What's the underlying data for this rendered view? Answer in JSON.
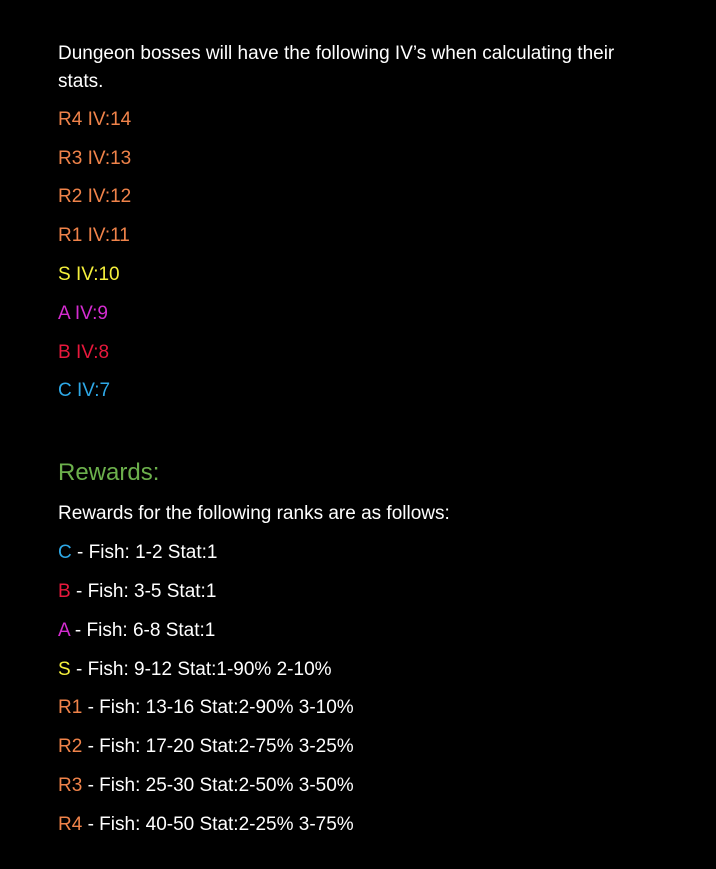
{
  "colors": {
    "background": "#000000",
    "text": "#ffffff",
    "rank_R": "#f0834a",
    "rank_S": "#f5f03c",
    "rank_A": "#d42cd0",
    "rank_B": "#e8183c",
    "rank_C": "#2ea8e6",
    "heading": "#6cb04c"
  },
  "intro": "Dungeon bosses will have the following IV’s when calculating their stats.",
  "ivs": [
    {
      "text": "R4 IV:14",
      "color": "#f0834a"
    },
    {
      "text": "R3 IV:13",
      "color": "#f0834a"
    },
    {
      "text": "R2 IV:12",
      "color": "#f0834a"
    },
    {
      "text": "R1 IV:11",
      "color": "#f0834a"
    },
    {
      "text": "S IV:10",
      "color": "#f5f03c"
    },
    {
      "text": "A IV:9",
      "color": "#d42cd0"
    },
    {
      "text": "B IV:8",
      "color": "#e8183c"
    },
    {
      "text": "C IV:7",
      "color": "#2ea8e6"
    }
  ],
  "rewards_heading": "Rewards:",
  "rewards_intro": "Rewards for the following ranks are as follows:",
  "rewards": [
    {
      "rank": "C",
      "color": "#2ea8e6",
      "detail": " - Fish: 1-2 Stat:1"
    },
    {
      "rank": "B",
      "color": "#e8183c",
      "detail": " - Fish: 3-5 Stat:1"
    },
    {
      "rank": "A",
      "color": "#d42cd0",
      "detail": " - Fish: 6-8 Stat:1"
    },
    {
      "rank": "S",
      "color": "#f5f03c",
      "detail": " - Fish: 9-12 Stat:1-90% 2-10%"
    },
    {
      "rank": "R1",
      "color": "#f0834a",
      "detail": " - Fish: 13-16 Stat:2-90% 3-10%"
    },
    {
      "rank": "R2",
      "color": "#f0834a",
      "detail": " - Fish: 17-20 Stat:2-75% 3-25%"
    },
    {
      "rank": "R3",
      "color": "#f0834a",
      "detail": " - Fish: 25-30 Stat:2-50% 3-50%"
    },
    {
      "rank": "R4",
      "color": "#f0834a",
      "detail": " - Fish: 40-50 Stat:2-25% 3-75%"
    }
  ]
}
